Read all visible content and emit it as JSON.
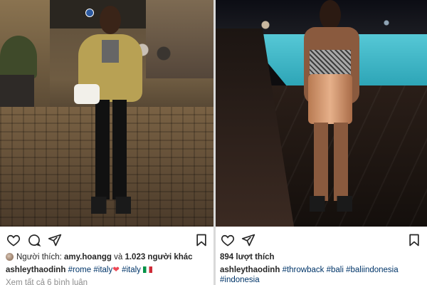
{
  "left_post": {
    "likes": {
      "prefix": "Người thích: ",
      "user": "amy.hoangg",
      "middle": " và ",
      "others": "1.023 người khác"
    },
    "caption": {
      "username": "ashleythaodinh",
      "tags": [
        "#rome",
        "#italy",
        "#italy"
      ]
    },
    "comments_link": "Xem tất cả 6 bình luận"
  },
  "right_post": {
    "likes_count": "894 lượt thích",
    "caption": {
      "username": "ashleythaodinh",
      "tags": [
        "#throwback",
        "#bali",
        "#baliindonesia",
        "#indonesia"
      ]
    }
  },
  "icons": {
    "like": "heart-outline-icon",
    "comment": "comment-bubble-icon",
    "share": "paper-plane-icon",
    "save": "bookmark-icon"
  },
  "colors": {
    "text": "#262626",
    "hashtag": "#003569",
    "muted": "#8e8e8e",
    "heart": "#ed4956"
  }
}
